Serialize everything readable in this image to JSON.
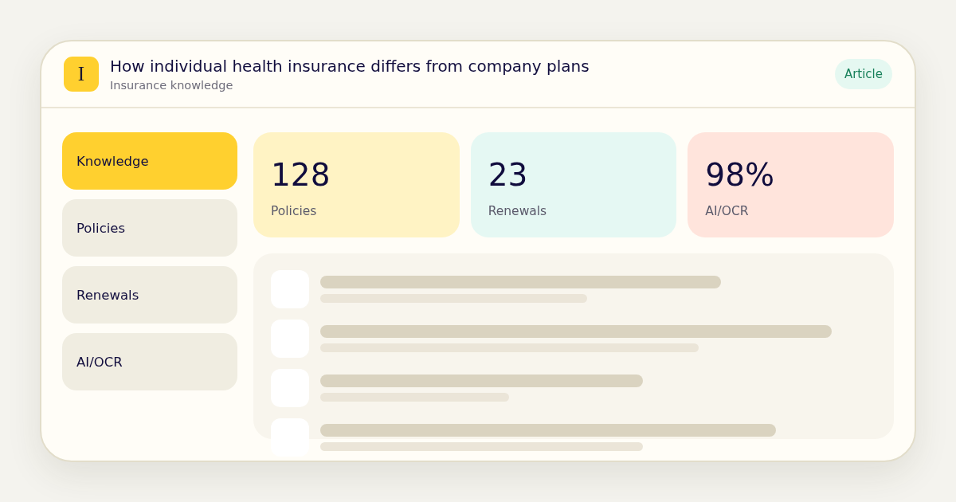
{
  "header": {
    "logo_letter": "I",
    "title": "How individual health insurance differs from company plans",
    "subtitle": "Insurance knowledge",
    "tag": "Article"
  },
  "sidebar": {
    "items": [
      {
        "label": "Knowledge",
        "selected": true
      },
      {
        "label": "Policies",
        "selected": false
      },
      {
        "label": "Renewals",
        "selected": false
      },
      {
        "label": "AI/OCR",
        "selected": false
      }
    ]
  },
  "stats": [
    {
      "value": "128",
      "label": "Policies",
      "color": "#fff3c4"
    },
    {
      "value": "23",
      "label": "Renewals",
      "color": "#e5f8f3"
    },
    {
      "value": "98%",
      "label": "AI/OCR",
      "color": "#ffe4dc"
    }
  ]
}
